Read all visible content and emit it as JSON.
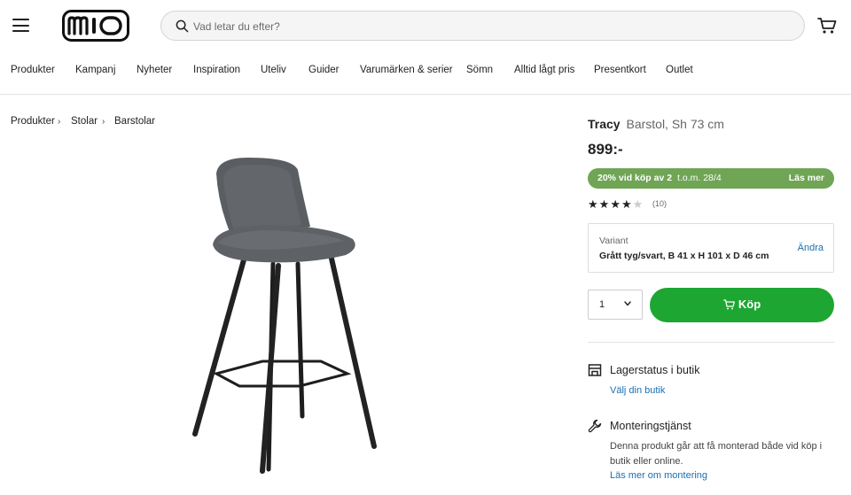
{
  "header": {
    "logo_text": "mio",
    "search_placeholder": "Vad letar du efter?"
  },
  "nav": {
    "items": [
      "Produkter",
      "Kampanj",
      "Nyheter",
      "Inspiration",
      "Uteliv",
      "Guider",
      "Varumärken & serier",
      "Sömn",
      "Alltid lågt pris",
      "Presentkort",
      "Outlet"
    ]
  },
  "breadcrumb": {
    "items": [
      "Produkter",
      "Stolar",
      "Barstolar"
    ]
  },
  "product": {
    "name": "Tracy",
    "subtitle": "Barstol, Sh 73 cm",
    "price": "899:-",
    "image_alt_icon": "bar-stool-image"
  },
  "promo": {
    "text": "20% vid köp av 2",
    "date": "t.o.m. 28/4",
    "link": "Läs mer",
    "color": "#6fa554"
  },
  "rating": {
    "value": 4,
    "max": 5,
    "count": "(10)"
  },
  "variant": {
    "label": "Variant",
    "value": "Grått tyg/svart, B 41 x H 101 x D 46 cm",
    "change_label": "Ändra"
  },
  "purchase": {
    "quantity": "1",
    "buy_label": "Köp",
    "buy_color": "#1ea633"
  },
  "store_status": {
    "title": "Lagerstatus i butik",
    "link": "Välj din butik",
    "icon": "store-icon"
  },
  "assembly": {
    "title": "Monteringstjänst",
    "text": "Denna produkt går att få monterad både vid köp i butik eller online.",
    "link": "Läs mer om montering",
    "icon": "wrench-icon"
  }
}
